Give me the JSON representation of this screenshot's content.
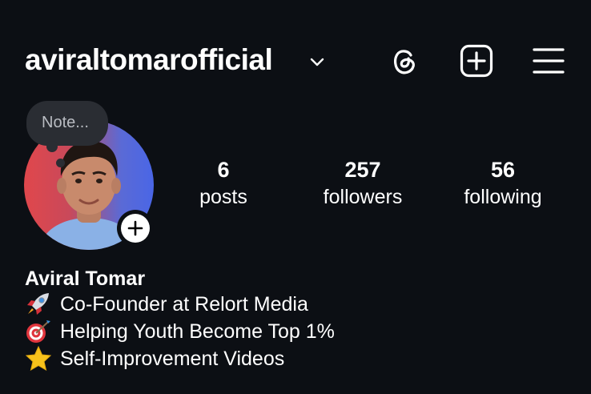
{
  "header": {
    "username": "aviraltomarofficial",
    "icons": {
      "account_switch": "chevron-down-icon",
      "threads": "threads-icon",
      "new_post": "plus-square-icon",
      "menu": "hamburger-menu-icon"
    }
  },
  "profile": {
    "note_placeholder": "Note...",
    "avatar_gradient": [
      "#e0474c",
      "#4a66e6"
    ],
    "add_story_icon": "plus-icon"
  },
  "stats": [
    {
      "value": "6",
      "label": "posts"
    },
    {
      "value": "257",
      "label": "followers"
    },
    {
      "value": "56",
      "label": "following"
    }
  ],
  "bio": {
    "full_name": "Aviral Tomar",
    "lines": [
      {
        "emoji": "rocket-icon",
        "text": "Co-Founder at Relort Media"
      },
      {
        "emoji": "target-icon",
        "text": "Helping Youth Become Top 1%"
      },
      {
        "emoji": "star-icon",
        "text": "Self-Improvement Videos"
      }
    ]
  },
  "colors": {
    "background": "#0c0f14",
    "text": "#ffffff",
    "note_bubble": "#2a2d33"
  }
}
